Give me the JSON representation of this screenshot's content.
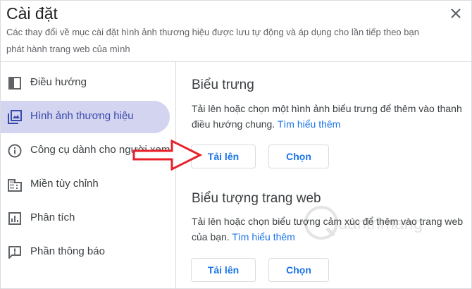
{
  "dialog": {
    "title": "Cài đặt",
    "description": "Các thay đổi về mục cài đặt hình ảnh thương hiệu được lưu tự động và áp dụng cho lần tiếp theo bạn phát hành trang web của mình"
  },
  "sidebar": {
    "items": [
      {
        "label": "Điều hướng",
        "icon": "navigation-panel-icon"
      },
      {
        "label": "Hình ảnh thương hiệu",
        "icon": "branding-image-icon",
        "active": true
      },
      {
        "label": "Công cụ dành cho người xem",
        "icon": "info-icon"
      },
      {
        "label": "Miền tùy chỉnh",
        "icon": "domain-building-icon"
      },
      {
        "label": "Phân tích",
        "icon": "analytics-icon"
      },
      {
        "label": "Phần thông báo",
        "icon": "announcement-icon"
      }
    ]
  },
  "logo_section": {
    "title": "Biểu trưng",
    "text": "Tải lên hoặc chọn một hình ảnh biểu trưng để thêm vào thanh điều hướng chung.",
    "link": "Tìm hiểu thêm",
    "upload_label": "Tải lên",
    "choose_label": "Chọn"
  },
  "favicon_section": {
    "title": "Biểu tượng trang web",
    "text": "Tải lên hoặc chọn biểu tượng cảm xúc để thêm vào trang web của bạn.",
    "link": "Tìm hiểu thêm",
    "upload_label": "Tải lên",
    "choose_label": "Chọn"
  },
  "watermark": {
    "text": "uantrimang"
  },
  "colors": {
    "accent": "#1a73e8",
    "active_bg": "#d2d4f0",
    "arrow": "#e8202a"
  }
}
